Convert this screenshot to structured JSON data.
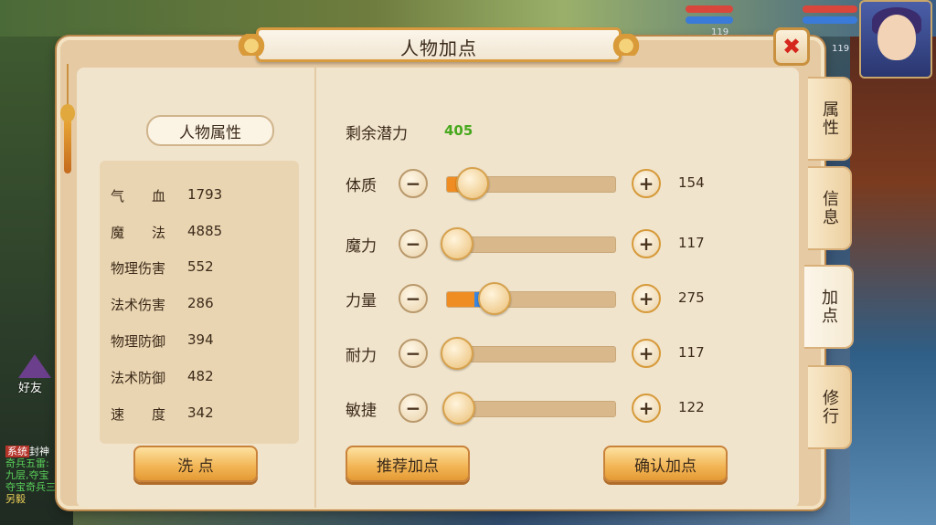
{
  "panel": {
    "title": "人物加点",
    "close_label": "✖"
  },
  "left": {
    "section_title": "人物属性",
    "attributes": [
      {
        "name": "气　　血",
        "value": "1793"
      },
      {
        "name": "魔　　法",
        "value": "4885"
      },
      {
        "name": "物理伤害",
        "value": "552"
      },
      {
        "name": "法术伤害",
        "value": "286"
      },
      {
        "name": "物理防御",
        "value": "394"
      },
      {
        "name": "法术防御",
        "value": "482"
      },
      {
        "name": "速　　度",
        "value": "342"
      }
    ],
    "reset_button": "洗 点"
  },
  "right": {
    "potential_label": "剩余潜力",
    "potential_value": "405",
    "minus_label": "−",
    "plus_label": "+",
    "stats": [
      {
        "label": "体质",
        "value": "154",
        "slider_fill": 0.1,
        "added_fill": 0
      },
      {
        "label": "魔力",
        "value": "117",
        "slider_fill": 0.01,
        "added_fill": 0
      },
      {
        "label": "力量",
        "value": "275",
        "slider_fill": 0.16,
        "added_fill": 0.07
      },
      {
        "label": "耐力",
        "value": "117",
        "slider_fill": 0.01,
        "added_fill": 0
      },
      {
        "label": "敏捷",
        "value": "122",
        "slider_fill": 0.02,
        "added_fill": 0
      }
    ],
    "recommend_button": "推荐加点",
    "confirm_button": "确认加点"
  },
  "tabs": [
    {
      "label": "属性",
      "active": false
    },
    {
      "label": "信息",
      "active": false
    },
    {
      "label": "加点",
      "active": true
    },
    {
      "label": "修行",
      "active": false
    }
  ],
  "hud": {
    "level_1": "119",
    "level_2": "119"
  },
  "overlay": {
    "friend_label": "好友",
    "chat_tag": "系统",
    "chat_lines": [
      "封神",
      "奇兵五雷:",
      "九层,夺宝",
      "夺宝奇兵三",
      "另毅"
    ]
  },
  "colors": {
    "accent": "#f2b453",
    "potential": "#47a81e",
    "fill_base": "#ef8d22",
    "fill_added": "#3a86e0"
  }
}
